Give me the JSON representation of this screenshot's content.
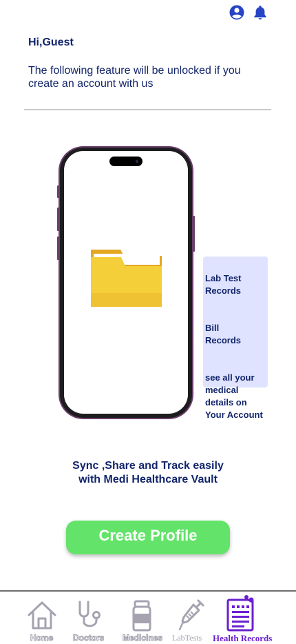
{
  "header": {
    "profile_icon": "account-circle-icon",
    "notification_icon": "bell-icon",
    "icon_color": "#2743c6"
  },
  "greeting": "Hi,Guest",
  "intro": "The following feature will be unlocked if you create an account with us",
  "illustration": {
    "device": "phone-icon",
    "content": "folder-icon",
    "frame_color": "#6b3f6a",
    "folder_color": "#f4cf3a"
  },
  "feature_card": {
    "items": [
      "Lab Test\nRecords",
      "Bill\nRecords",
      "see all your\n medical\ndetails on\nYour Account"
    ],
    "background": "#dfe3ff"
  },
  "tagline": {
    "line1": "Sync ,Share and Track easily",
    "line2": "with Medi Healthcare Vault"
  },
  "cta": {
    "label": "Create Profile",
    "color": "#63e36a"
  },
  "bottom_nav": {
    "items": [
      {
        "label": "Home",
        "icon": "home-icon",
        "active": false
      },
      {
        "label": "Doctors",
        "icon": "stethoscope-icon",
        "active": false
      },
      {
        "label": "Medicines",
        "icon": "pill-bottle-icon",
        "active": false
      },
      {
        "label": "LabTests",
        "icon": "syringe-icon",
        "active": false
      },
      {
        "label": "Health Records",
        "icon": "clipboard-icon",
        "active": true
      }
    ],
    "active_color": "#6a1fd1",
    "inactive_color": "#a6a2b0"
  }
}
